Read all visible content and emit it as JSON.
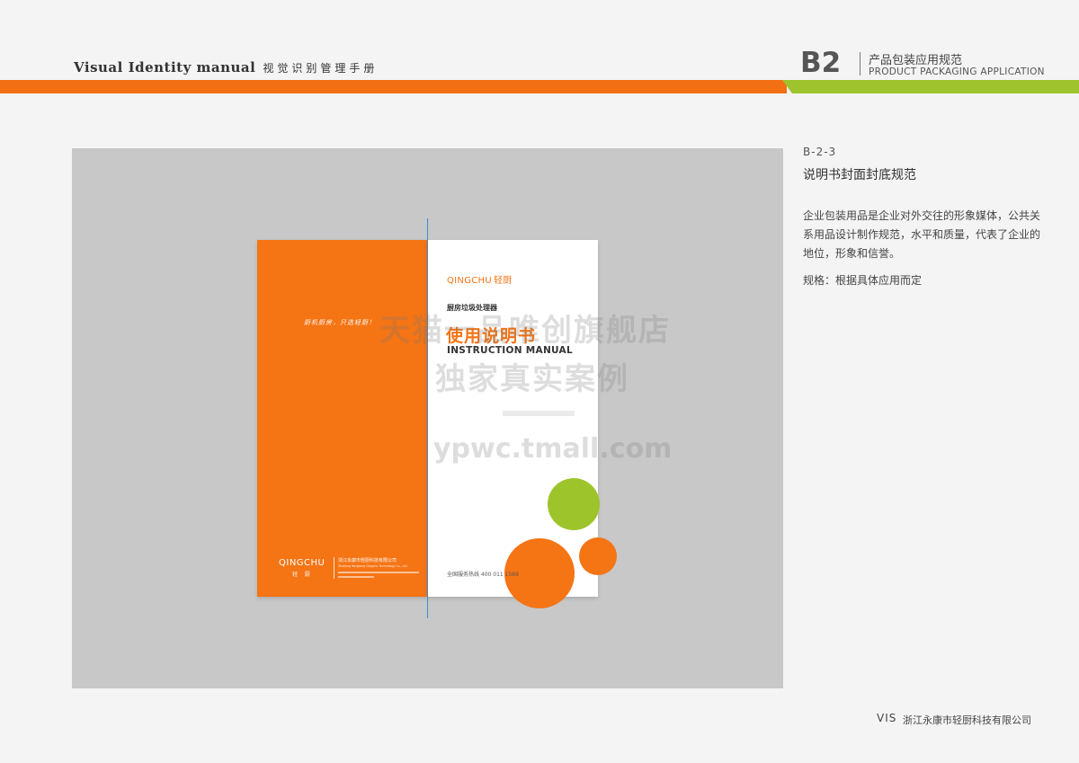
{
  "header": {
    "vi_en": "Visual Identity  manual",
    "vi_cn": "视觉识别管理手册",
    "section_code": "B2",
    "section_cn": "产品包装应用规范",
    "section_en": "PRODUCT PACKAGING APPLICATION",
    "colors": {
      "orange": "#f36f13",
      "green": "#9ec32c"
    }
  },
  "mockup": {
    "back": {
      "slogan": "厨机厨房，只选轻厨！",
      "logo_en": "QINGCHU",
      "logo_cn": "轻 厨",
      "company": "浙江永康市轻厨科技有限公司",
      "company_en": "Zhejiang Yongkang Qingchu Technology Co., Ltd."
    },
    "front": {
      "logo_en": "QINGCHU",
      "logo_cn": "轻厨",
      "subtitle": "厨房垃圾处理器",
      "title": "使用说明书",
      "title_en": "INSTRUCTION MANUAL",
      "hotline": "全国服务热线  400 011 1569"
    },
    "colors": {
      "orange": "#f57414",
      "green": "#9dc52b"
    }
  },
  "watermark": {
    "line1": "天猫一品唯创旗舰店",
    "line2": "独家真实案例",
    "line3": "ypwc.tmall.com"
  },
  "info": {
    "code": "B-2-3",
    "title": "说明书封面封底规范",
    "description": "企业包装用品是企业对外交往的形象媒体，公共关系用品设计制作规范，水平和质量，代表了企业的地位，形象和信誉。",
    "spec": "规格：根据具体应用而定"
  },
  "footer": {
    "vis": "VIS",
    "company": "浙江永康市轻厨科技有限公司"
  }
}
